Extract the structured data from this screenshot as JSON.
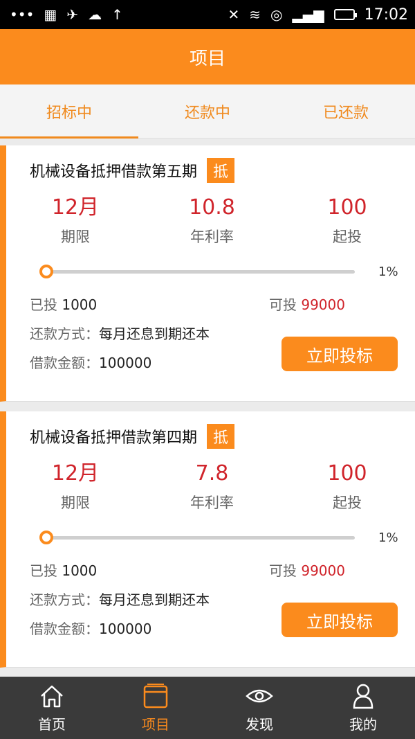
{
  "status_bar": {
    "left_icons": [
      "more-dots-icon",
      "grid-icon",
      "satellite-icon",
      "cloud-icon",
      "upload-arrow-icon"
    ],
    "right_icons": [
      "mute-icon",
      "wifi-icon",
      "data-icon",
      "signal-icon",
      "battery-icon"
    ],
    "time": "17:02"
  },
  "header": {
    "title": "项目"
  },
  "tabs": [
    {
      "label": "招标中",
      "active": true
    },
    {
      "label": "还款中",
      "active": false
    },
    {
      "label": "已还款",
      "active": false
    }
  ],
  "projects": [
    {
      "title": "机械设备抵押借款第五期",
      "badge": "抵",
      "term_value": "12月",
      "term_label": "期限",
      "rate_value": "10.8",
      "rate_label": "年利率",
      "min_value": "100",
      "min_label": "起投",
      "progress": 0.01,
      "progress_text": "1%",
      "invested_label": "已投",
      "invested_value": "1000",
      "available_label": "可投",
      "available_value": "99000",
      "repay_label": "还款方式：",
      "repay_value": "每月还息到期还本",
      "amount_label": "借款金额：",
      "amount_value": "100000",
      "button": "立即投标"
    },
    {
      "title": "机械设备抵押借款第四期",
      "badge": "抵",
      "term_value": "12月",
      "term_label": "期限",
      "rate_value": "7.8",
      "rate_label": "年利率",
      "min_value": "100",
      "min_label": "起投",
      "progress": 0.01,
      "progress_text": "1%",
      "invested_label": "已投",
      "invested_value": "1000",
      "available_label": "可投",
      "available_value": "99000",
      "repay_label": "还款方式：",
      "repay_value": "每月还息到期还本",
      "amount_label": "借款金额：",
      "amount_value": "100000",
      "button": "立即投标"
    }
  ],
  "bottom_nav": [
    {
      "label": "首页",
      "icon": "home-icon",
      "active": false
    },
    {
      "label": "项目",
      "icon": "wallet-icon",
      "active": true
    },
    {
      "label": "发现",
      "icon": "eye-icon",
      "active": false
    },
    {
      "label": "我的",
      "icon": "user-icon",
      "active": false
    }
  ],
  "colors": {
    "accent": "#fb8b1d",
    "highlight": "#d0242b",
    "nav_bg": "#3a3a3a"
  }
}
